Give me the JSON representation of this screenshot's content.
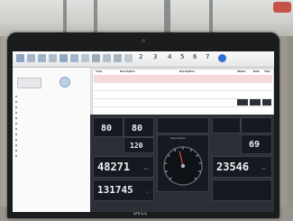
{
  "toolbar": {
    "buttons": [
      {
        "icon": "file-icon",
        "color": "#8da4c4",
        "label": ""
      },
      {
        "icon": "open-icon",
        "color": "#a7b5c7",
        "label": ""
      },
      {
        "icon": "save-icon",
        "color": "#9cb3c9",
        "label": ""
      },
      {
        "icon": "print-icon",
        "color": "#b0bac5",
        "label": ""
      },
      {
        "icon": "read-icon",
        "color": "#8fa8c2",
        "label": ""
      },
      {
        "icon": "clear-icon",
        "color": "#a3b6c9",
        "label": ""
      },
      {
        "icon": "report-icon",
        "color": "#b8c4d0",
        "label": ""
      },
      {
        "icon": "tools-icon",
        "color": "#9aa9bb",
        "label": ""
      },
      {
        "icon": "sensor-icon",
        "color": "#b4bec9",
        "label": ""
      },
      {
        "icon": "monitor-icon",
        "color": "#a9b4c0",
        "label": ""
      },
      {
        "icon": "chart-icon",
        "color": "#c0c8d0",
        "label": ""
      }
    ],
    "numbered": [
      "2",
      "3",
      "4",
      "5",
      "6",
      "7"
    ],
    "help_icon_color": "#2f6fd1"
  },
  "sidebar": {
    "title": "",
    "items": [
      "",
      "",
      "",
      "",
      "",
      "",
      "",
      "",
      "",
      "",
      "",
      ""
    ]
  },
  "table": {
    "headers": [
      "Code",
      "Description",
      "Description",
      "Status",
      "Date",
      "Time"
    ],
    "rows": [
      {
        "cols": [
          "",
          "",
          "",
          "",
          "",
          ""
        ],
        "highlight": true
      },
      {
        "cols": [
          "",
          "",
          "",
          "",
          "",
          ""
        ],
        "highlight": false
      },
      {
        "cols": [
          "",
          "",
          "",
          "",
          "",
          ""
        ],
        "highlight": false
      },
      {
        "cols": [
          "",
          "",
          "",
          "",
          "",
          ""
        ],
        "highlight": false
      }
    ]
  },
  "dashboard": {
    "tiles": [
      {
        "title": "",
        "value": "80",
        "unit": ""
      },
      {
        "title": "",
        "value": "80",
        "unit": ""
      },
      {
        "title": "",
        "value": "",
        "unit": ""
      },
      {
        "title": "",
        "value": "120",
        "unit": ""
      },
      {
        "title": "",
        "value": "",
        "unit": ""
      },
      {
        "title": "",
        "value": "69",
        "unit": ""
      },
      {
        "title": "",
        "value": "",
        "unit": ""
      }
    ],
    "odometer": "48271",
    "odometer_unit": "km",
    "hours": "131745",
    "hours_unit": "h",
    "trip": "23546",
    "trip_unit": "km",
    "gauge_title": "Engine Speed",
    "gauge_level": 0.45,
    "accent": "#e9eef2",
    "background": "#2b2f36"
  },
  "laptop": {
    "brand": "DELL"
  }
}
